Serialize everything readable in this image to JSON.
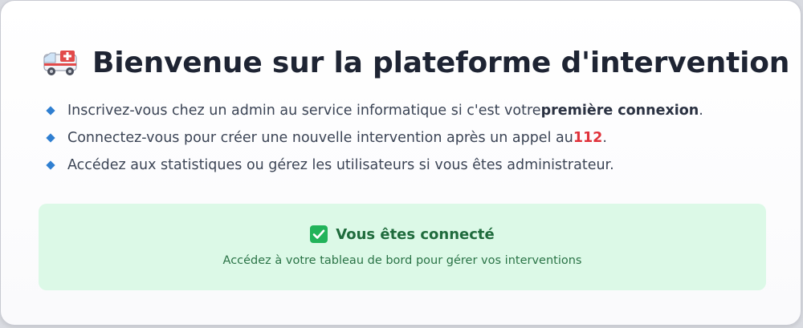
{
  "header": {
    "icon": "ambulance-icon",
    "title": "Bienvenue sur la plateforme d'intervention"
  },
  "instructions": [
    {
      "text": "Inscrivez-vous chez un admin au service informatique si c'est votre ",
      "emphasis": "première connexion",
      "suffix": "."
    },
    {
      "text": "Connectez-vous pour créer une nouvelle intervention après un appel au ",
      "emphasis": "112",
      "suffix": "."
    },
    {
      "text": "Accédez aux statistiques ou gérez les utilisateurs si vous êtes administrateur."
    }
  ],
  "status": {
    "icon": "check-box-icon",
    "title": "Vous êtes connecté",
    "subtitle": "Accédez à votre tableau de bord pour gérer vos interventions"
  },
  "colors": {
    "accent_blue": "#2f7fd1",
    "emergency_red": "#e0323b",
    "success_bg": "#dcf9e7",
    "success_text": "#1f6b3c"
  }
}
